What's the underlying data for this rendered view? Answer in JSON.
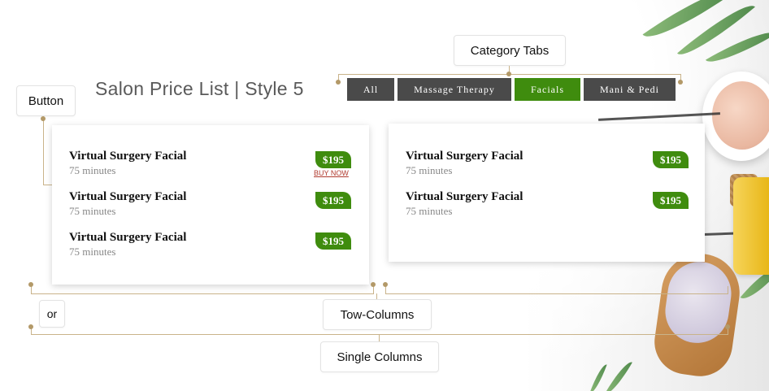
{
  "page": {
    "title": "Salon Price List | Style 5"
  },
  "tabs": [
    {
      "label": "All",
      "active": false
    },
    {
      "label": "Massage Therapy",
      "active": false
    },
    {
      "label": "Facials",
      "active": true
    },
    {
      "label": "Mani & Pedi",
      "active": false
    }
  ],
  "callouts": {
    "category_tabs": "Category Tabs",
    "button": "Button",
    "or": "or",
    "two_columns": "Tow-Columns",
    "single_columns": "Single Columns"
  },
  "left_card": {
    "items": [
      {
        "name": "Virtual Surgery Facial",
        "duration": "75 minutes",
        "price": "$195"
      },
      {
        "name": "Virtual Surgery Facial",
        "duration": "75 minutes",
        "price": "$195"
      },
      {
        "name": "Virtual Surgery Facial",
        "duration": "75 minutes",
        "price": "$195"
      }
    ],
    "buy_now": "BUY NOW"
  },
  "right_card": {
    "items": [
      {
        "name": "Virtual Surgery Facial",
        "duration": "75 minutes",
        "price": "$195"
      },
      {
        "name": "Virtual Surgery Facial",
        "duration": "75 minutes",
        "price": "$195"
      }
    ]
  },
  "colors": {
    "accent_green": "#3f8c0e",
    "tab_dark": "#4a4a4a",
    "connector": "#c9b38a",
    "buy_now_red": "#b03a2e"
  }
}
